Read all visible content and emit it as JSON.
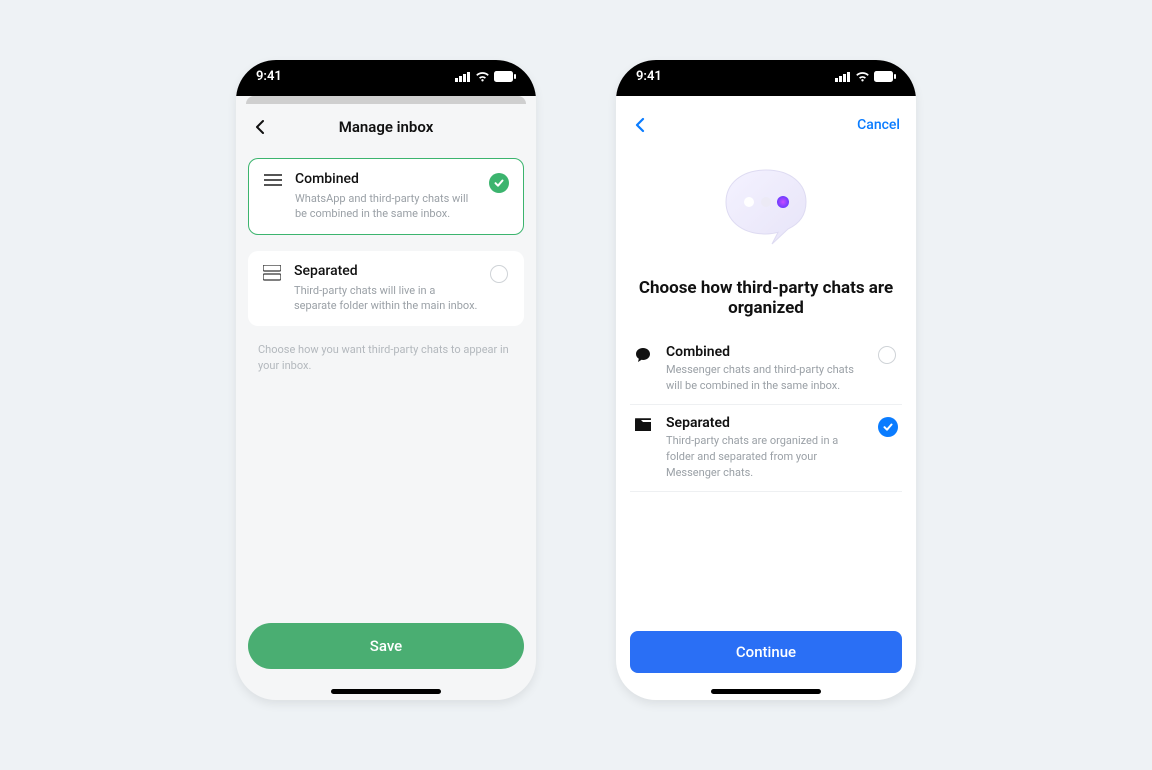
{
  "status": {
    "time": "9:41"
  },
  "wa": {
    "header_title": "Manage inbox",
    "options": [
      {
        "title": "Combined",
        "desc": "WhatsApp and third-party chats will be combined in the same inbox.",
        "selected": true
      },
      {
        "title": "Separated",
        "desc": "Third-party chats will live in a separate folder within the main inbox.",
        "selected": false
      }
    ],
    "hint": "Choose how you want third-party chats to appear in your inbox.",
    "save_label": "Save"
  },
  "ms": {
    "cancel_label": "Cancel",
    "heading": "Choose how third-party chats are organized",
    "options": [
      {
        "title": "Combined",
        "desc": "Messenger chats and third-party chats will be combined in the same inbox.",
        "selected": false
      },
      {
        "title": "Separated",
        "desc": "Third-party chats are organized in a folder and separated from your Messenger chats.",
        "selected": true
      }
    ],
    "continue_label": "Continue"
  },
  "colors": {
    "wa_accent": "#3cb46e",
    "ms_accent": "#0a7cff",
    "ms_button": "#2a6ff5"
  }
}
